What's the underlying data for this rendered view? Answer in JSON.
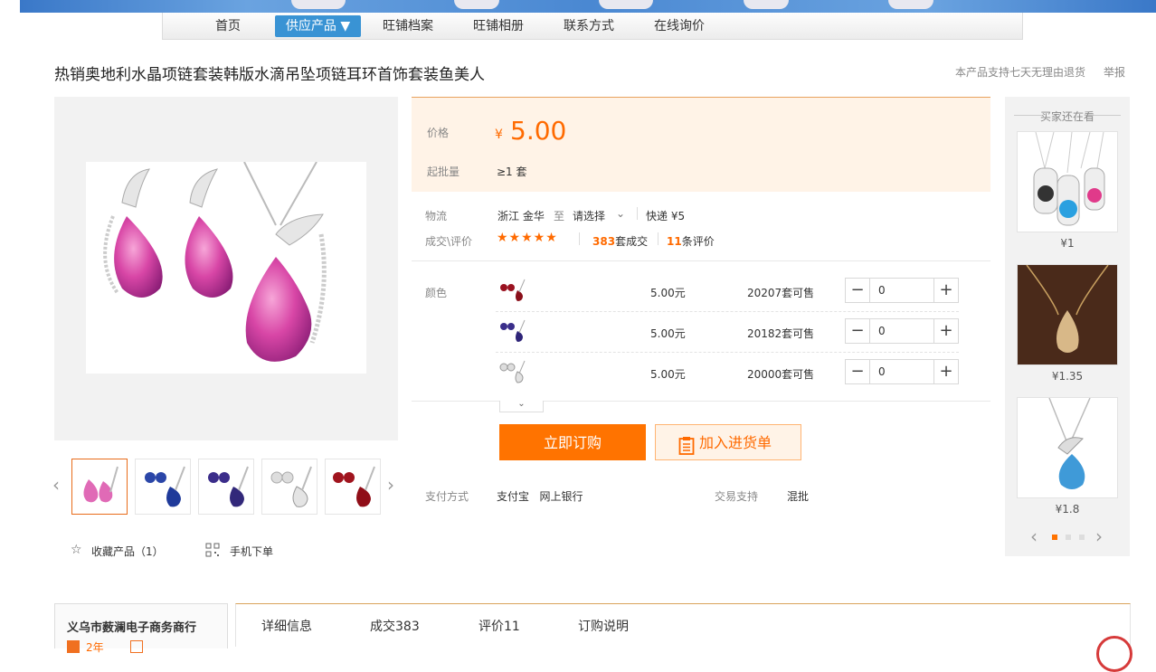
{
  "nav": {
    "items": [
      {
        "label": "首页"
      },
      {
        "label": "供应产品 ▼"
      },
      {
        "label": "旺铺档案"
      },
      {
        "label": "旺铺相册"
      },
      {
        "label": "联系方式"
      },
      {
        "label": "在线询价"
      }
    ],
    "active_index": 1
  },
  "product": {
    "title": "热销奥地利水晶项链套装韩版水滴吊坠项链耳环首饰套装鱼美人",
    "return_policy": "本产品支持七天无理由退货",
    "report": "举报"
  },
  "price": {
    "label": "价格",
    "currency": "¥",
    "value": "5.00",
    "moq_label": "起批量",
    "moq_value": "≥1 套"
  },
  "logistics": {
    "label": "物流",
    "origin": "浙江 金华",
    "to": "至",
    "destination": "请选择",
    "shipping": "快递 ¥5"
  },
  "deals": {
    "label": "成交\\评价",
    "stars": "★★★★★",
    "rating": 5,
    "sold_count": "383",
    "sold_suffix": "套成交",
    "review_count": "11",
    "review_suffix": "条评价"
  },
  "variants": {
    "label": "颜色",
    "rows": [
      {
        "price": "5.00元",
        "stock": "20207套可售",
        "qty": "0"
      },
      {
        "price": "5.00元",
        "stock": "20182套可售",
        "qty": "0"
      },
      {
        "price": "5.00元",
        "stock": "20000套可售",
        "qty": "0"
      }
    ],
    "expand_icon": "chevron-down-icon"
  },
  "actions": {
    "buy_now": "立即订购",
    "add_to_list": "加入进货单"
  },
  "payment": {
    "label": "支付方式",
    "methods": "支付宝   网上银行",
    "trade_label": "交易支持",
    "trade_value": "混批"
  },
  "gallery_actions": {
    "favorite": "收藏产品（1）",
    "mobile_order": "手机下单"
  },
  "recommend": {
    "title": "买家还在看",
    "items": [
      {
        "price": "¥1"
      },
      {
        "price": "¥1.35"
      },
      {
        "price": "¥1.8"
      }
    ],
    "page": 1,
    "page_count": 3
  },
  "shop": {
    "name": "义乌市薮澜电子商务商行",
    "years": "2年"
  },
  "tabs": [
    {
      "label": "详细信息"
    },
    {
      "label": "成交383"
    },
    {
      "label": "评价11"
    },
    {
      "label": "订购说明"
    }
  ],
  "colors": {
    "accent": "#ff7300",
    "price": "#ff6a00",
    "nav_active": "#3993d4",
    "price_bg": "#fff3e7"
  }
}
